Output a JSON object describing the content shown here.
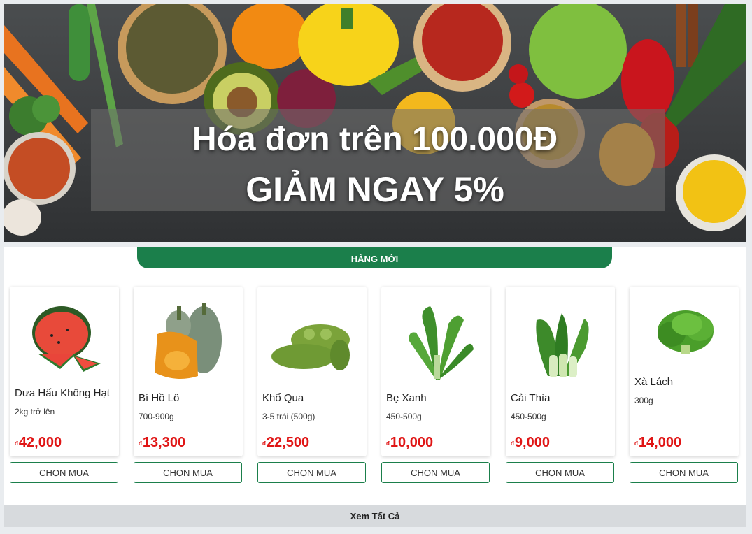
{
  "banner": {
    "line1": "Hóa đơn trên 100.000Đ",
    "line2": "GIẢM NGAY 5%"
  },
  "section": {
    "title": "HÀNG MỚI",
    "see_all_label": "Xem Tất Cả",
    "currency_symbol": "đ",
    "buy_label": "CHỌN MUA"
  },
  "products": [
    {
      "name": "Dưa Hấu Không Hạt",
      "weight": "2kg trở lên",
      "price": "42,000",
      "icon": "watermelon-icon"
    },
    {
      "name": "Bí Hồ Lô",
      "weight": "700-900g",
      "price": "13,300",
      "icon": "pumpkin-icon"
    },
    {
      "name": "Khổ Qua",
      "weight": "3-5 trái (500g)",
      "price": "22,500",
      "icon": "bitter-melon-icon"
    },
    {
      "name": "Bẹ Xanh",
      "weight": "450-500g",
      "price": "10,000",
      "icon": "mustard-greens-icon"
    },
    {
      "name": "Cải Thìa",
      "weight": "450-500g",
      "price": "9,000",
      "icon": "bok-choy-icon"
    },
    {
      "name": "Xà Lách",
      "weight": "300g",
      "price": "14,000",
      "icon": "lettuce-icon"
    }
  ],
  "colors": {
    "accent": "#1b7f4b",
    "price": "#e01515",
    "background": "#e9ecef"
  }
}
